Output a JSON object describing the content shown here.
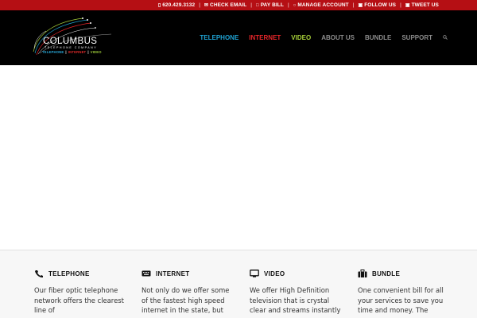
{
  "topbar": {
    "phone": "620.429.3132",
    "check_email": "CHECK EMAIL",
    "pay_bill": "PAY BILL",
    "manage_account": "MANAGE ACCOUNT",
    "follow_us": "FOLLOW US",
    "tweet_us": "TWEET US",
    "background": "#b50f14"
  },
  "logo": {
    "name": "COLUMBUS",
    "subtitle": "TELEPHONE COMPANY",
    "tag_telephone": "TELEPHONE",
    "tag_internet": "INTERNET",
    "tag_video": "VIDEO",
    "separator": "|"
  },
  "nav": {
    "items": [
      {
        "label": "TELEPHONE",
        "color": "#1fa2d2"
      },
      {
        "label": "INTERNET",
        "color": "#e8262a"
      },
      {
        "label": "VIDEO",
        "color": "#a6ce39"
      },
      {
        "label": "ABOUT US",
        "color": "#8c8c8c"
      },
      {
        "label": "BUNDLE",
        "color": "#8c8c8c"
      },
      {
        "label": "SUPPORT",
        "color": "#8c8c8c"
      }
    ],
    "search_icon": "search-icon"
  },
  "services": [
    {
      "title": "TELEPHONE",
      "icon": "phone-icon",
      "text": "Our fiber optic telephone network offers the clearest line of"
    },
    {
      "title": "INTERNET",
      "icon": "keyboard-icon",
      "text": "Not only do we offer some of the fastest high speed internet in the state, but"
    },
    {
      "title": "VIDEO",
      "icon": "tv-icon",
      "text": "We offer High Definition television that is crystal clear and streams instantly"
    },
    {
      "title": "BUNDLE",
      "icon": "briefcase-icon",
      "text": "One convenient bill for all your services to save you time and money. The"
    }
  ]
}
